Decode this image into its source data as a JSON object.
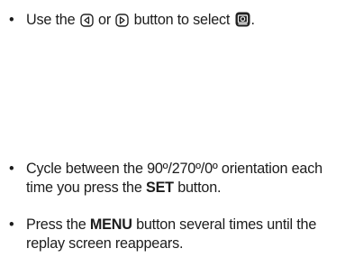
{
  "bullets": [
    {
      "marker": "•",
      "before": "Use the",
      "left_icon": "left-arrow-button-icon",
      "middle": "or",
      "right_icon": "right-arrow-button-icon",
      "after": "button to select",
      "target_icon": "rotate-image-icon",
      "end": "."
    },
    {
      "marker": "•",
      "text": "Cycle between the 90º/270º/0º orientation each time you press the",
      "keyword": "SET",
      "tail": "button."
    },
    {
      "marker": "•",
      "lead": "Press the",
      "keyword": "MENU",
      "tail": "button several times until the replay screen reappears."
    }
  ]
}
